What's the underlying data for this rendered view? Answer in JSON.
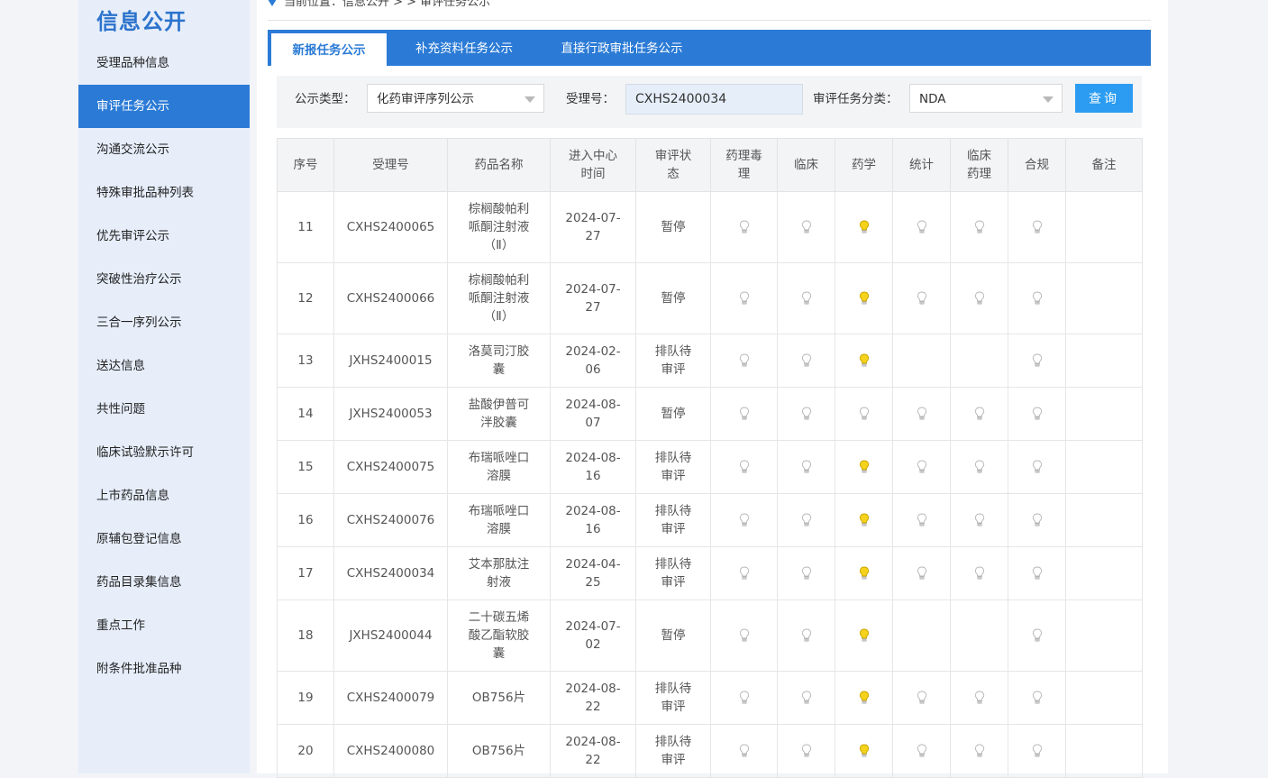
{
  "sidebar": {
    "title": "信息公开",
    "items": [
      {
        "label": "受理品种信息",
        "active": false
      },
      {
        "label": "审评任务公示",
        "active": true
      },
      {
        "label": "沟通交流公示",
        "active": false
      },
      {
        "label": "特殊审批品种列表",
        "active": false
      },
      {
        "label": "优先审评公示",
        "active": false
      },
      {
        "label": "突破性治疗公示",
        "active": false
      },
      {
        "label": "三合一序列公示",
        "active": false
      },
      {
        "label": "送达信息",
        "active": false
      },
      {
        "label": "共性问题",
        "active": false
      },
      {
        "label": "临床试验默示许可",
        "active": false
      },
      {
        "label": "上市药品信息",
        "active": false
      },
      {
        "label": "原辅包登记信息",
        "active": false
      },
      {
        "label": "药品目录集信息",
        "active": false
      },
      {
        "label": "重点工作",
        "active": false
      },
      {
        "label": "附条件批准品种",
        "active": false
      }
    ]
  },
  "breadcrumb": "当前位置：信息公开 > > 审评任务公示",
  "tabs": [
    {
      "label": "新报任务公示",
      "active": true
    },
    {
      "label": "补充资料任务公示",
      "active": false
    },
    {
      "label": "直接行政审批任务公示",
      "active": false
    }
  ],
  "filters": {
    "type_label": "公示类型：",
    "type_value": "化药审评序列公示",
    "accept_label": "受理号：",
    "accept_value": "CXHS2400034",
    "category_label": "审评任务分类：",
    "category_value": "NDA",
    "query_button": "查询"
  },
  "table": {
    "headers": [
      "序号",
      "受理号",
      "药品名称",
      "进入中心时间",
      "审评状态",
      "药理毒理",
      "临床",
      "药学",
      "统计",
      "临床药理",
      "合规",
      "备注"
    ],
    "header_lines": [
      [
        "序号"
      ],
      [
        "受理号"
      ],
      [
        "药品名称"
      ],
      [
        "进入中心",
        "时间"
      ],
      [
        "审评状",
        "态"
      ],
      [
        "药理毒",
        "理"
      ],
      [
        "临床"
      ],
      [
        "药学"
      ],
      [
        "统计"
      ],
      [
        "临床",
        "药理"
      ],
      [
        "合规"
      ],
      [
        "备注"
      ]
    ],
    "rows": [
      {
        "no": "11",
        "id": "CXHS2400065",
        "name": [
          "棕榈酸帕利",
          "哌酮注射液",
          "（Ⅱ）"
        ],
        "date": [
          "2024-07-",
          "27"
        ],
        "status": [
          "暂停"
        ],
        "bulbs": [
          "off",
          "off",
          "on",
          "off",
          "off",
          "off"
        ],
        "highlight": false
      },
      {
        "no": "12",
        "id": "CXHS2400066",
        "name": [
          "棕榈酸帕利",
          "哌酮注射液",
          "（Ⅱ）"
        ],
        "date": [
          "2024-07-",
          "27"
        ],
        "status": [
          "暂停"
        ],
        "bulbs": [
          "off",
          "off",
          "on",
          "off",
          "off",
          "off"
        ],
        "highlight": false
      },
      {
        "no": "13",
        "id": "JXHS2400015",
        "name": [
          "洛莫司汀胶",
          "囊"
        ],
        "date": [
          "2024-02-",
          "06"
        ],
        "status": [
          "排队待",
          "审评"
        ],
        "bulbs": [
          "off",
          "off",
          "on",
          "",
          "",
          "off"
        ],
        "highlight": false
      },
      {
        "no": "14",
        "id": "JXHS2400053",
        "name": [
          "盐酸伊普可",
          "泮胶囊"
        ],
        "date": [
          "2024-08-",
          "07"
        ],
        "status": [
          "暂停"
        ],
        "bulbs": [
          "off",
          "off",
          "off",
          "off",
          "off",
          "off"
        ],
        "highlight": false
      },
      {
        "no": "15",
        "id": "CXHS2400075",
        "name": [
          "布瑞哌唑口",
          "溶膜"
        ],
        "date": [
          "2024-08-",
          "16"
        ],
        "status": [
          "排队待",
          "审评"
        ],
        "bulbs": [
          "off",
          "off",
          "on",
          "off",
          "off",
          "off"
        ],
        "highlight": false
      },
      {
        "no": "16",
        "id": "CXHS2400076",
        "name": [
          "布瑞哌唑口",
          "溶膜"
        ],
        "date": [
          "2024-08-",
          "16"
        ],
        "status": [
          "排队待",
          "审评"
        ],
        "bulbs": [
          "off",
          "off",
          "on",
          "off",
          "off",
          "off"
        ],
        "highlight": false
      },
      {
        "no": "17",
        "id": "CXHS2400034",
        "name": [
          "艾本那肽注",
          "射液"
        ],
        "date": [
          "2024-04-",
          "25"
        ],
        "status": [
          "排队待",
          "审评"
        ],
        "bulbs": [
          "off",
          "off",
          "on",
          "off",
          "off",
          "off"
        ],
        "highlight": true
      },
      {
        "no": "18",
        "id": "JXHS2400044",
        "name": [
          "二十碳五烯",
          "酸乙酯软胶",
          "囊"
        ],
        "date": [
          "2024-07-",
          "02"
        ],
        "status": [
          "暂停"
        ],
        "bulbs": [
          "off",
          "off",
          "on",
          "",
          "",
          "off"
        ],
        "highlight": false
      },
      {
        "no": "19",
        "id": "CXHS2400079",
        "name": [
          "OB756片"
        ],
        "date": [
          "2024-08-",
          "22"
        ],
        "status": [
          "排队待",
          "审评"
        ],
        "bulbs": [
          "off",
          "off",
          "on",
          "off",
          "off",
          "off"
        ],
        "highlight": false
      },
      {
        "no": "20",
        "id": "CXHS2400080",
        "name": [
          "OB756片"
        ],
        "date": [
          "2024-08-",
          "22"
        ],
        "status": [
          "排队待",
          "审评"
        ],
        "bulbs": [
          "off",
          "off",
          "on",
          "off",
          "off",
          "off"
        ],
        "highlight": false
      }
    ]
  },
  "colors": {
    "accent": "#2b7bd6",
    "button": "#2b9cf2",
    "highlight": "#d0282f",
    "bulb_on": "#f5d21c",
    "bulb_off": "#d8d8d8"
  }
}
